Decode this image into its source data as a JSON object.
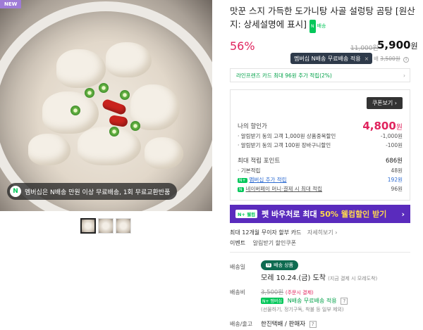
{
  "product": {
    "new_badge": "NEW",
    "title": "맛꾼 스지 가득한 도가니탕 사골 설렁탕 곰탕 [원산지: 상세설명에 표시]",
    "title_tag": "배송",
    "image_banner": "멤버십은 N배송 만원 이상 무료배송, 1회 무료교환반품",
    "discount_pct": "56%",
    "orig_price": "11,000원",
    "sale_price": "5,900",
    "sale_price_unit": "원"
  },
  "tooltip": {
    "text": "멤버십 N배송 무료배송 적용",
    "close": "×"
  },
  "shipping_fee_line": {
    "label": "배",
    "value": "3,500원",
    "info": "i"
  },
  "card_bar": {
    "text": "라인프렌즈 카드 최대 96원 추가 적립(2%)",
    "chevron": "›"
  },
  "benefit_box": {
    "coupon_button": "쿠폰보기 ›",
    "my_discount_label": "나의 할인가",
    "my_discount_value": "4,800",
    "my_discount_unit": "원",
    "items": [
      {
        "label": "알림받기 동의 고객 1,000원 상품중복할인",
        "value": "-1,000원"
      },
      {
        "label": "알림받기 동의 고객 100원 장바구니할인",
        "value": "-100원"
      }
    ],
    "points_label": "최대 적립 포인트",
    "points_value": "686원",
    "points_items": [
      {
        "badge": "",
        "label": "기본적립",
        "value": "48원"
      },
      {
        "badge": "N+",
        "label": "멤버십 추가 적립",
        "value": "192원"
      },
      {
        "badge": "N",
        "label": "네이버페이 머니·결제 시 최대 적립",
        "value": "96원"
      }
    ]
  },
  "promo": {
    "badge": "N+ 웰컴",
    "text": "펫 바우처로 최대",
    "highlight": "50% 웰컴할인 받기",
    "arrow": "›"
  },
  "installment": {
    "text": "최대 12개월 무이자 할부 카드",
    "link": "자세히보기 ›"
  },
  "event": {
    "label": "이벤트",
    "text": "알림받기 할인쿠폰"
  },
  "delivery": {
    "label": "배송일",
    "tag": "배송 상품",
    "tag_icon": "N",
    "date": "모레 10.24.(금) 도착",
    "date_note": "(지금 결제 시 모레도착)"
  },
  "shipping_fee": {
    "label": "배송비",
    "orig": "3,500원",
    "note": "(주문시 결제)",
    "membership": "N배송 무료배송 적용",
    "membership_badge": "N+ 멤버십",
    "sub_note": "(선물하기, 정기구독, 착불 등 일부 제외)"
  },
  "delivery_company": {
    "label": "배송/출고",
    "value": "한진택배 / 판매자",
    "info": "?"
  }
}
